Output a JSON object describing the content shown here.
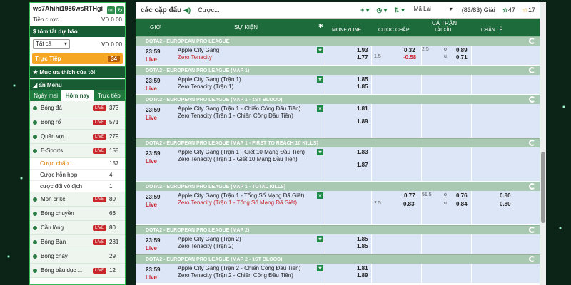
{
  "account": {
    "name": "ws7Ahihi1986wsRTHgi",
    "credit_label": "Tiền cược",
    "credit_value": "VD 0.00"
  },
  "summary": {
    "title": "tóm tắt dự báo",
    "select": "Tất cả",
    "value": "VD 0.00"
  },
  "live": {
    "label": "Trực Tiếp",
    "count": "34"
  },
  "favorites": {
    "label": "Mục ưa thích của tôi"
  },
  "menu": {
    "label": "ẩn Menu",
    "tabs": [
      "Ngày mai",
      "Hôm nay",
      "Trực tiếp"
    ]
  },
  "sports": [
    {
      "label": "Bóng đá",
      "live": "LIVE",
      "count": "373"
    },
    {
      "label": "Bóng rổ",
      "live": "LIVE",
      "count": "571"
    },
    {
      "label": "Quần vợt",
      "live": "LIVE",
      "count": "279"
    },
    {
      "label": "E-Sports",
      "live": "LIVE",
      "count": "158"
    }
  ],
  "esports_sub": [
    {
      "label": "Cược chấp ...",
      "count": "157"
    },
    {
      "label": "Cược hỗn hợp",
      "count": "4"
    },
    {
      "label": "cược đối vô địch",
      "count": "1"
    }
  ],
  "sports2": [
    {
      "label": "Môn crikê",
      "live": "LIVE",
      "count": "80"
    },
    {
      "label": "Bóng chuyền",
      "live": "",
      "count": "66"
    },
    {
      "label": "Cầu lông",
      "live": "LIVE",
      "count": "80"
    },
    {
      "label": "Bóng Bàn",
      "live": "LIVE",
      "count": "281"
    },
    {
      "label": "Bóng chày",
      "live": "",
      "count": "29"
    },
    {
      "label": "Bóng bầu dục ...",
      "live": "LIVE",
      "count": "12"
    }
  ],
  "topbar": {
    "title": "các cặp đấu",
    "bet_label": "Cược...",
    "odds_type": "Mã Lai",
    "page": "(83/83) Giải",
    "fav_count": "47",
    "refresh": "17"
  },
  "table": {
    "col_time": "GIỜ",
    "col_event": "SỰ KIỆN",
    "full_time": "CẢ TRẬN",
    "moneyline": "MONEYLINE",
    "handicap": "CƯỢC CHẤP",
    "over_under": "TÀI XỈU",
    "odd_even": "CHẴN LẺ"
  },
  "leagues": [
    {
      "name": "DOTA2 - EUROPEAN PRO LEAGUE",
      "time": "23:59",
      "live": "Live",
      "team1": "Apple City Gang",
      "team2": "Zero Tenacity",
      "ml1": "1.93",
      "ml2": "1.77",
      "hdp2": "1.5",
      "h1": "0.32",
      "h2": "-0.58",
      "ou_line": "2.5",
      "o": "0.89",
      "u": "0.71",
      "ou_o": "o",
      "ou_u": "u"
    },
    {
      "name": "DOTA2 - EUROPEAN PRO LEAGUE (MAP 1)",
      "time": "23:59",
      "live": "Live",
      "team1": "Apple City Gang (Trận 1)",
      "team2": "Zero Tenacity (Trận 1)",
      "ml1": "1.85",
      "ml2": "1.85"
    },
    {
      "name": "DOTA2 - EUROPEAN PRO LEAGUE (MAP 1 - 1ST BLOOD)",
      "time": "23:59",
      "live": "Live",
      "team1": "Apple City Gang (Trận 1 - Chiến Công Đầu Tiên)",
      "team2": "Zero Tenacity (Trận 1 - Chiến Công Đầu Tiên)",
      "ml1": "1.81",
      "ml2": "1.89"
    },
    {
      "name": "DOTA2 - EUROPEAN PRO LEAGUE (MAP 1 - FIRST TO REACH 10 KILLS)",
      "time": "23:59",
      "live": "Live",
      "team1": "Apple City Gang (Trận 1 - Giết 10 Mạng Đầu Tiên)",
      "team2": "Zero Tenacity (Trận 1 - Giết 10 Mạng Đầu Tiên)",
      "ml1": "1.83",
      "ml2": "1.87"
    },
    {
      "name": "DOTA2 - EUROPEAN PRO LEAGUE (MAP 1 - TOTAL KILLS)",
      "time": "23:59",
      "live": "Live",
      "team1": "Apple City Gang (Trận 1 - Tổng Số Mạng Đã Giết)",
      "team2": "Zero Tenacity (Trận 1 - Tổng Số Mạng Đã Giết)",
      "hdp2": "2.5",
      "h1": "0.77",
      "h2": "0.83",
      "ou_line": "51.5",
      "o": "0.76",
      "u": "0.84",
      "ou_o": "o",
      "ou_u": "u",
      "oe1": "0.80",
      "oe2": "0.80"
    },
    {
      "name": "DOTA2 - EUROPEAN PRO LEAGUE (MAP 2)",
      "time": "23:59",
      "live": "Live",
      "team1": "Apple City Gang (Trận 2)",
      "team2": "Zero Tenacity (Trận 2)",
      "ml1": "1.85",
      "ml2": "1.85"
    },
    {
      "name": "DOTA2 - EUROPEAN PRO LEAGUE (MAP 2 - 1ST BLOOD)",
      "time": "23:59",
      "live": "Live",
      "team1": "Apple City Gang (Trận 2 - Chiến Công Đầu Tiên)",
      "team2": "Zero Tenacity (Trận 2 - Chiến Công Đầu Tiên)",
      "ml1": "1.81",
      "ml2": "1.89"
    }
  ]
}
